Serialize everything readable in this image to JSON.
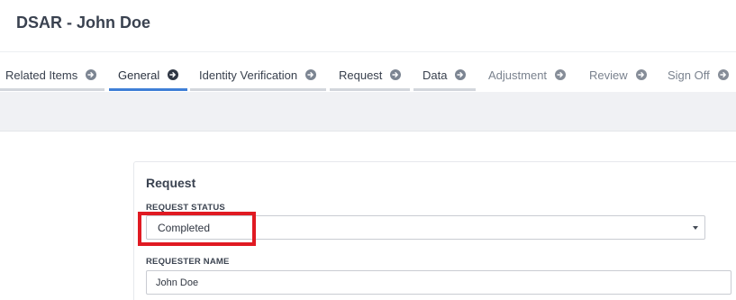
{
  "header": {
    "title": "DSAR - John Doe"
  },
  "tabs": [
    {
      "label": "Related Items",
      "state": "done"
    },
    {
      "label": "General",
      "state": "active"
    },
    {
      "label": "Identity Verification",
      "state": "done"
    },
    {
      "label": "Request",
      "state": "done"
    },
    {
      "label": "Data",
      "state": "done"
    },
    {
      "label": "Adjustment",
      "state": "pending"
    },
    {
      "label": "Review",
      "state": "pending"
    },
    {
      "label": "Sign Off",
      "state": "pending"
    }
  ],
  "tab_icon": "arrow-circle-right-icon",
  "form": {
    "section_title": "Request",
    "request_status": {
      "label": "REQUEST STATUS",
      "value": "Completed",
      "icon": "caret-down-icon"
    },
    "requester_name": {
      "label": "REQUESTER NAME",
      "value": "John Doe"
    }
  },
  "colors": {
    "accent": "#3f7fd6",
    "highlight": "#e01a22",
    "band": "#f0f1f4"
  }
}
